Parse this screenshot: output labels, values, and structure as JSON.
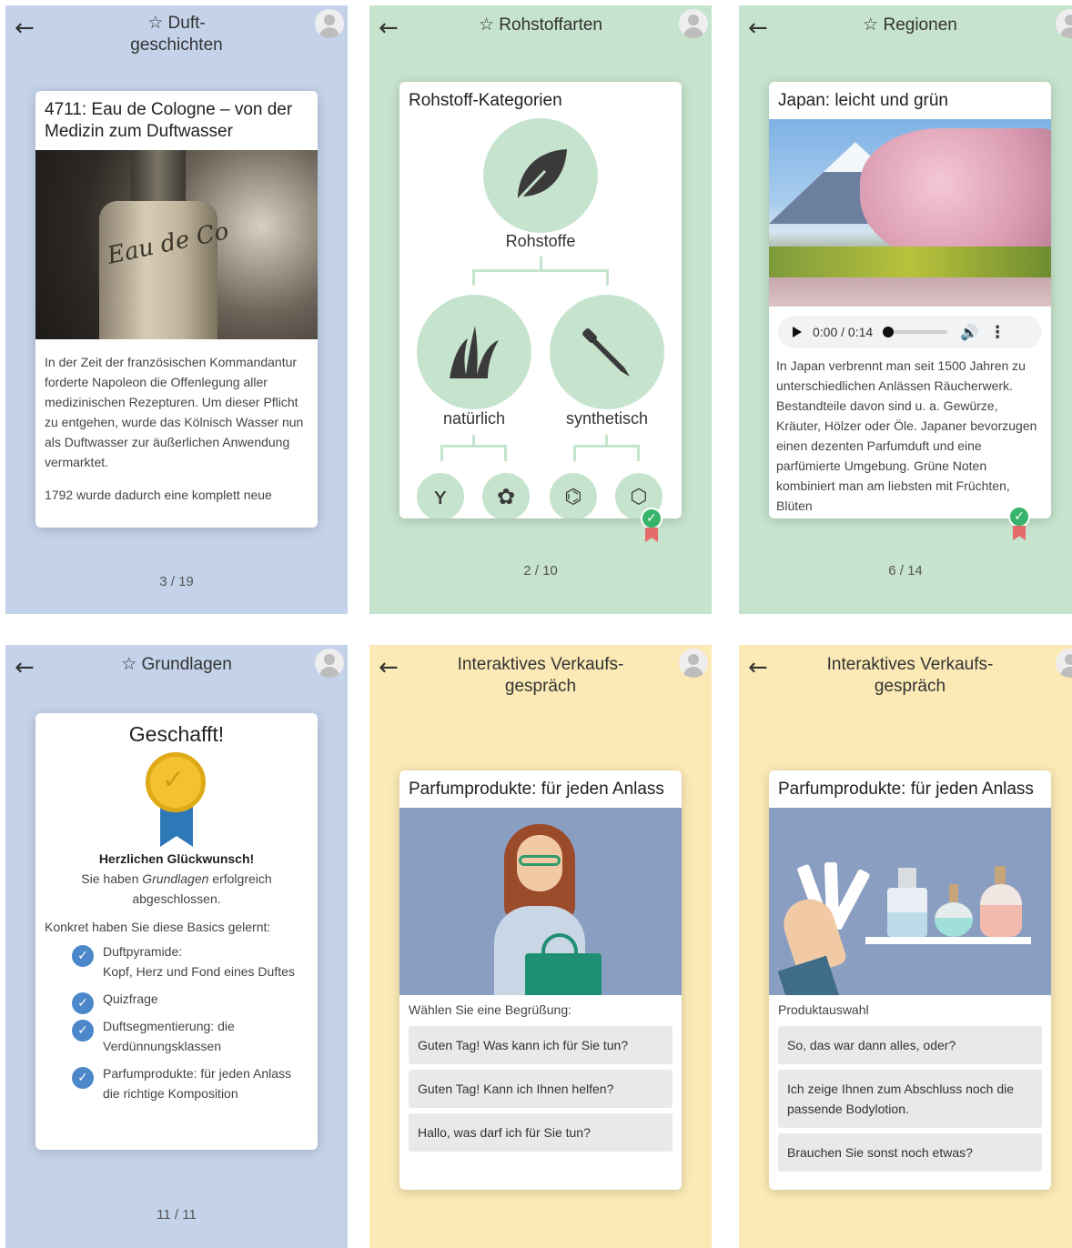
{
  "icons": {
    "back": "back-arrow-icon",
    "avatar": "user-avatar-icon",
    "check": "check-icon"
  },
  "colors": {
    "blue": "#c4d3ea",
    "green": "#c6e3cd",
    "yellow": "#fbeab6",
    "accent_blue": "#4b87c9",
    "success": "#38b36b"
  },
  "panel1": {
    "title": "☆ Duft-\ngeschichten",
    "card_title": "4711: Eau de Cologne – von der Medizin zum Duftwasser",
    "image_script": "Eau de Co",
    "p1": "In der Zeit der französischen Kommandantur forderte Napoleon die Offenlegung aller medizinischen Rezepturen. Um dieser Pflicht zu entgehen, wurde das Kölnisch Wasser nun als Duftwasser zur äußerlichen Anwendung vermarktet.",
    "p2": "1792 wurde dadurch eine komplett neue",
    "pager": "3 / 19"
  },
  "panel2": {
    "title": "☆ Rohstoffarten",
    "card_title": "Rohstoff-Kategorien",
    "root_label": "Rohstoffe",
    "left_label": "natürlich",
    "right_label": "synthetisch",
    "pager": "2 / 10"
  },
  "panel3": {
    "title": "☆ Regionen",
    "card_title": "Japan: leicht und grün",
    "audio_time": "0:00 / 0:14",
    "text": "In Japan verbrennt man seit 1500 Jahren zu unterschiedlichen Anlässen Räucherwerk. Bestandteile davon sind u. a. Gewürze, Kräuter, Hölzer oder Öle. Japaner bevorzugen einen dezenten Parfumduft und eine parfümierte Umgebung. Grüne Noten kombiniert man am liebsten mit Früchten, Blüten",
    "pager": "6 / 14"
  },
  "panel4": {
    "title": "☆ Grundlagen",
    "heading": "Geschafft!",
    "congrats_bold": "Herzlichen Glückwunsch!",
    "congrats_pre": "Sie haben ",
    "congrats_em": "Grundlagen",
    "congrats_post": " erfolgreich abgeschlossen.",
    "basics_intro": "Konkret haben Sie diese Basics gelernt:",
    "items": [
      "Duftpyramide:\nKopf, Herz und Fond eines Duftes",
      "Quizfrage",
      "Duftsegmentierung: die Verdünnungsklassen",
      "Parfumprodukte: für jeden Anlass die richtige Komposition"
    ],
    "pager": "11 / 11"
  },
  "panel5": {
    "title": "Interaktives Verkaufs-\ngespräch",
    "card_title": "Parfumprodukte: für jeden Anlass",
    "prompt": "Wählen Sie eine Begrüßung:",
    "choices": [
      "Guten Tag! Was kann ich für Sie tun?",
      "Guten Tag! Kann ich Ihnen helfen?",
      "Hallo, was darf ich für Sie tun?"
    ]
  },
  "panel6": {
    "title": "Interaktives Verkaufs-\ngespräch",
    "card_title": "Parfumprodukte: für jeden Anlass",
    "prompt": "Produktauswahl",
    "choices": [
      "So, das war dann alles, oder?",
      "Ich zeige Ihnen zum Abschluss noch die passende Bodylotion.",
      "Brauchen Sie sonst noch etwas?"
    ]
  }
}
